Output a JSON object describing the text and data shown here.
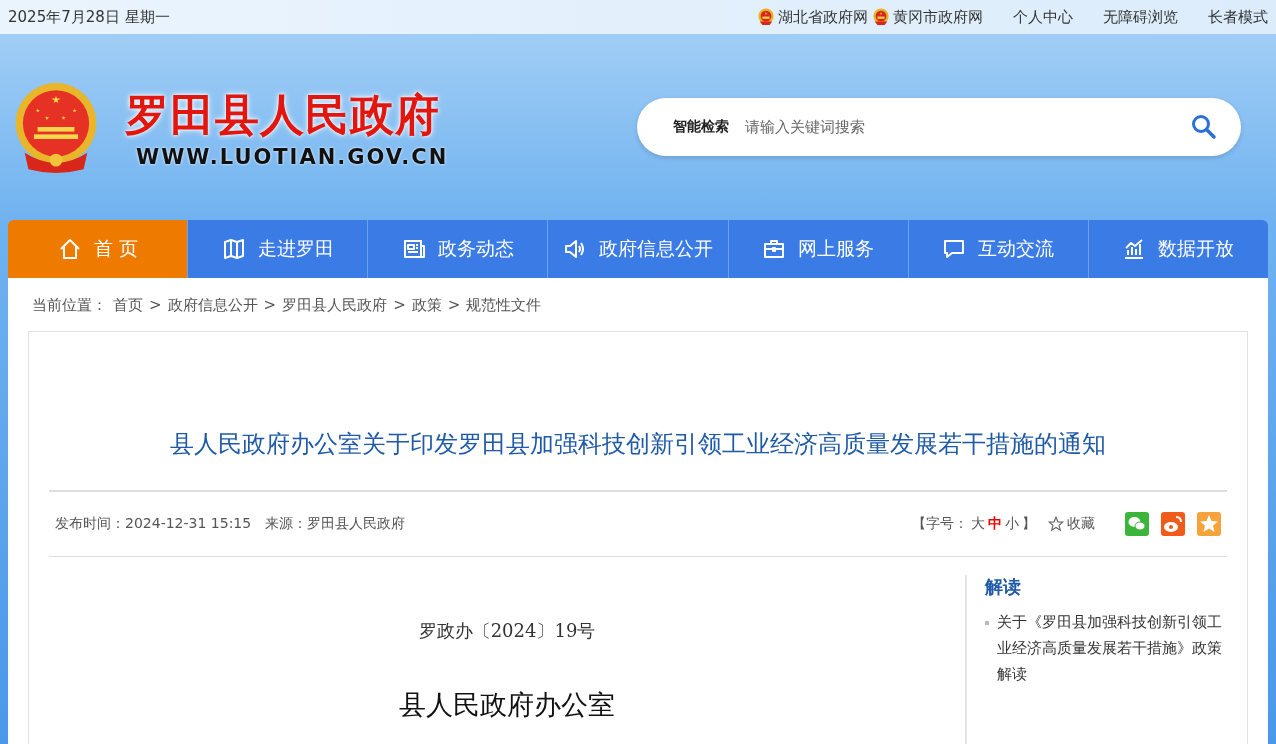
{
  "top_bar": {
    "date": "2025年7月28日 星期一",
    "links": [
      {
        "label": "湖北省政府网",
        "emblem": true
      },
      {
        "label": "黄冈市政府网",
        "emblem": true
      },
      {
        "label": "个人中心",
        "emblem": false
      },
      {
        "label": "无障碍浏览",
        "emblem": false
      },
      {
        "label": "长者模式",
        "emblem": false
      }
    ]
  },
  "header": {
    "site_name": "罗田县人民政府",
    "site_url": "WWW.LUOTIAN.GOV.CN",
    "search": {
      "label": "智能检索",
      "placeholder": "请输入关键词搜索"
    }
  },
  "nav": [
    {
      "label": "首 页",
      "selected": true
    },
    {
      "label": "走进罗田",
      "selected": false
    },
    {
      "label": "政务动态",
      "selected": false
    },
    {
      "label": "政府信息公开",
      "selected": false
    },
    {
      "label": "网上服务",
      "selected": false
    },
    {
      "label": "互动交流",
      "selected": false
    },
    {
      "label": "数据开放",
      "selected": false
    }
  ],
  "breadcrumb": {
    "label": "当前位置：",
    "separator": ">",
    "items": [
      "首页",
      "政府信息公开",
      "罗田县人民政府",
      "政策",
      "规范性文件"
    ]
  },
  "article": {
    "title": "县人民政府办公室关于印发罗田县加强科技创新引领工业经济高质量发展若干措施的通知",
    "publish_time": "发布时间：2024-12-31 15:15",
    "source": "来源：罗田县人民政府",
    "font_size": {
      "open": "【字号：",
      "close": "】",
      "options": [
        {
          "label": "大",
          "selected": false
        },
        {
          "label": "中",
          "selected": true
        },
        {
          "label": "小",
          "selected": false
        }
      ]
    },
    "favorite": "收藏",
    "doc_number": "罗政办〔2024〕19号",
    "issuer": "县人民政府办公室"
  },
  "sidebar": {
    "title": "解读",
    "items": [
      "关于《罗田县加强科技创新引领工业经济高质量发展若干措施》政策解读"
    ]
  }
}
